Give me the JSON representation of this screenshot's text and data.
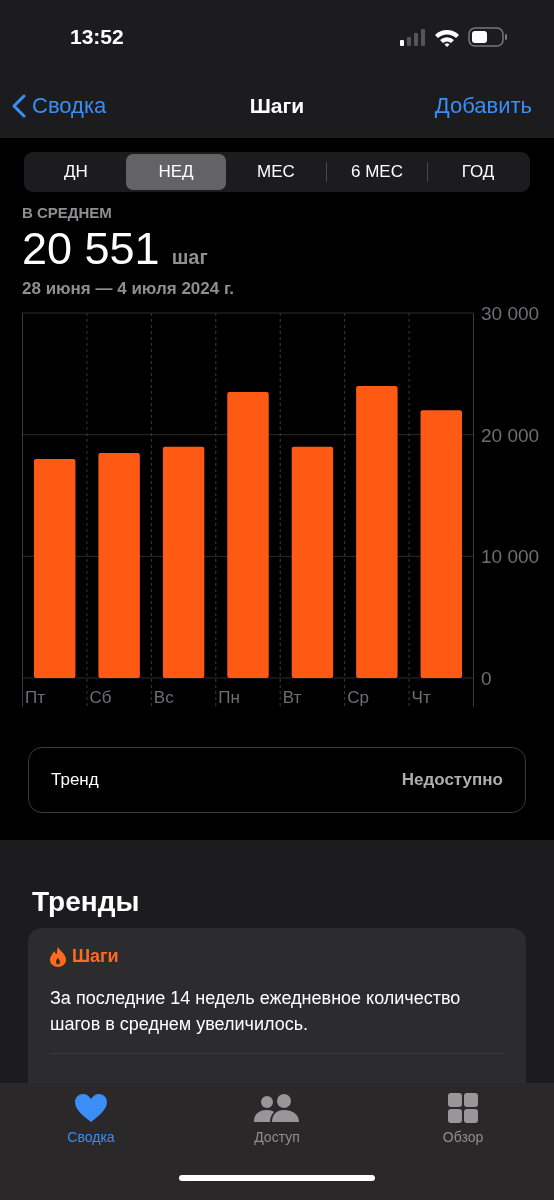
{
  "status_bar": {
    "time": "13:52"
  },
  "nav": {
    "back": "Сводка",
    "title": "Шаги",
    "action": "Добавить"
  },
  "segments": [
    {
      "label": "ДН",
      "selected": false
    },
    {
      "label": "НЕД",
      "selected": true
    },
    {
      "label": "МЕС",
      "selected": false
    },
    {
      "label": "6 МЕС",
      "selected": false
    },
    {
      "label": "ГОД",
      "selected": false
    }
  ],
  "summary": {
    "label": "В СРЕДНЕМ",
    "value": "20 551",
    "unit": "шаг",
    "range": "28 июня — 4 июля 2024 г."
  },
  "chart_data": {
    "type": "bar",
    "categories": [
      "Пт",
      "Сб",
      "Вс",
      "Пн",
      "Вт",
      "Ср",
      "Чт"
    ],
    "series": [
      {
        "color": "#ff5a14",
        "values": [
          18000,
          18500,
          19000,
          23500,
          19000,
          24000,
          22000
        ]
      }
    ],
    "ylim": [
      0,
      30000
    ],
    "yticks": [
      {
        "value": 0,
        "label": "0"
      },
      {
        "value": 10000,
        "label": "10 000"
      },
      {
        "value": 20000,
        "label": "20 000"
      },
      {
        "value": 30000,
        "label": "30 000"
      }
    ]
  },
  "trend_row": {
    "label": "Тренд",
    "value": "Недоступно"
  },
  "trends": {
    "title": "Тренды",
    "card": {
      "heading": "Шаги",
      "text": "За последние 14 недель ежедневное количество шагов в среднем увеличилось."
    }
  },
  "tab_bar": [
    {
      "kind": "heart",
      "label": "Сводка",
      "selected": true
    },
    {
      "kind": "people",
      "label": "Доступ",
      "selected": false
    },
    {
      "kind": "grid",
      "label": "Обзор",
      "selected": false
    }
  ]
}
